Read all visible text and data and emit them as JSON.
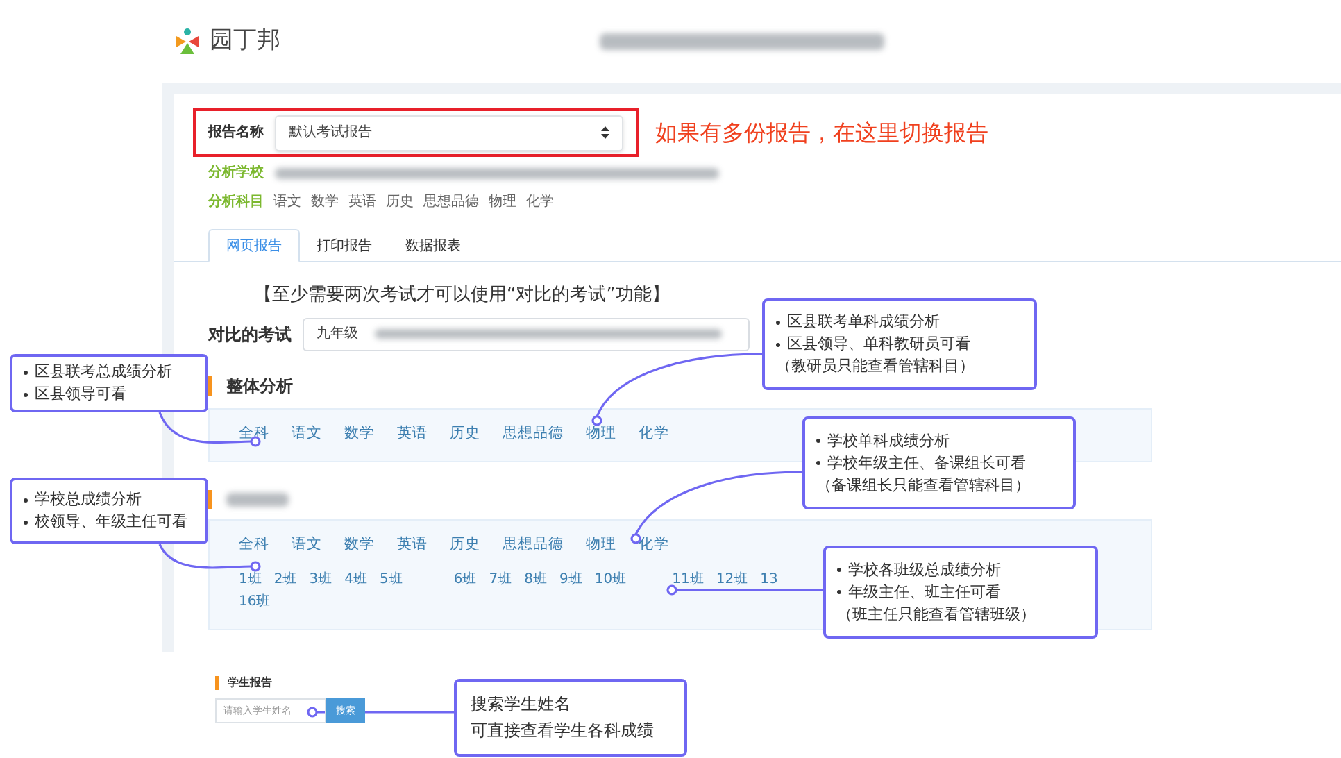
{
  "app": {
    "logo_text": "园丁邦"
  },
  "report_selector": {
    "label": "报告名称",
    "value": "默认考试报告"
  },
  "report_hint": "如果有多份报告，在这里切换报告",
  "school_label": "分析学校",
  "subjects_label": "分析科目",
  "subjects": [
    "语文",
    "数学",
    "英语",
    "历史",
    "思想品德",
    "物理",
    "化学"
  ],
  "tabs": [
    {
      "label": "网页报告",
      "selected": true
    },
    {
      "label": "打印报告",
      "selected": false
    },
    {
      "label": "数据报表",
      "selected": false
    }
  ],
  "notice": "【至少需要两次考试才可以使用“对比的考试”功能】",
  "compare": {
    "label": "对比的考试",
    "value": "九年级"
  },
  "overall": {
    "title": "整体分析",
    "subjects": [
      "全科",
      "语文",
      "数学",
      "英语",
      "历史",
      "思想品德",
      "物理",
      "化学"
    ]
  },
  "school_section": {
    "subjects": [
      "全科",
      "语文",
      "数学",
      "英语",
      "历史",
      "思想品德",
      "物理",
      "化学"
    ],
    "class_rows": [
      [
        "1班",
        "2班",
        "3班",
        "4班",
        "5班",
        "6班",
        "7班",
        "8班",
        "9班",
        "10班",
        "11班",
        "12班",
        "13"
      ],
      [
        "16班"
      ]
    ]
  },
  "student_report": {
    "title": "学生报告",
    "placeholder": "请输入学生姓名",
    "button": "搜索"
  },
  "callouts": [
    {
      "items": [
        {
          "kind": "bullet",
          "text": "区县联考总成绩分析"
        },
        {
          "kind": "bullet",
          "text": "区县领导可看"
        }
      ]
    },
    {
      "items": [
        {
          "kind": "bullet",
          "text": "学校总成绩分析"
        },
        {
          "kind": "bullet",
          "text": "校领导、年级主任可看"
        }
      ]
    },
    {
      "items": [
        {
          "kind": "bullet",
          "text": "区县联考单科成绩分析"
        },
        {
          "kind": "bullet",
          "text": "区县领导、单科教研员可看"
        },
        {
          "kind": "note",
          "text": "（教研员只能查看管辖科目）"
        }
      ]
    },
    {
      "items": [
        {
          "kind": "bullet",
          "text": "学校单科成绩分析"
        },
        {
          "kind": "bullet",
          "text": "学校年级主任、备课组长可看"
        },
        {
          "kind": "note",
          "text": "（备课组长只能查看管辖科目）"
        }
      ]
    },
    {
      "items": [
        {
          "kind": "bullet",
          "text": "学校各班级总成绩分析"
        },
        {
          "kind": "bullet",
          "text": "年级主任、班主任可看"
        },
        {
          "kind": "note",
          "text": "（班主任只能查看管辖班级）"
        }
      ]
    },
    {
      "items": [
        {
          "kind": "line",
          "text": "搜索学生姓名"
        },
        {
          "kind": "line",
          "text": "可直接查看学生各科成绩"
        }
      ]
    }
  ]
}
